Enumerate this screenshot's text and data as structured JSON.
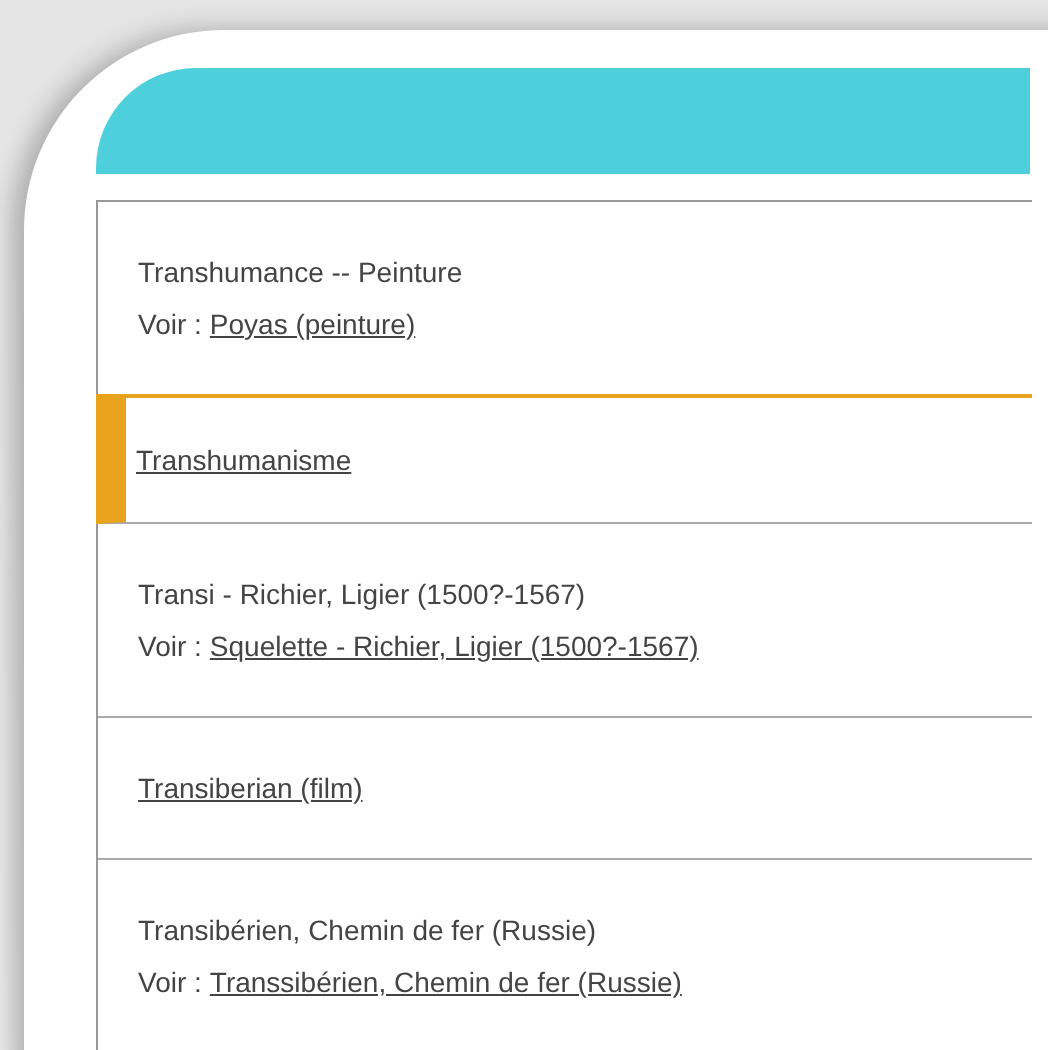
{
  "entries": [
    {
      "kind": "see",
      "heading": "Transhumance -- Peinture",
      "see_label": "Voir :",
      "see_link": "Poyas (peinture)",
      "selected": false
    },
    {
      "kind": "link",
      "link": "Transhumanisme",
      "selected": true
    },
    {
      "kind": "see",
      "heading": "Transi - Richier, Ligier (1500?-1567)",
      "see_label": "Voir :",
      "see_link": "Squelette - Richier, Ligier (1500?-1567)",
      "selected": false
    },
    {
      "kind": "link",
      "link": "Transiberian (film)",
      "selected": false
    },
    {
      "kind": "see",
      "heading": "Transibérien, Chemin de fer (Russie)",
      "see_label": "Voir :",
      "see_link": "Transsibérien, Chemin de fer (Russie)",
      "selected": false
    }
  ]
}
